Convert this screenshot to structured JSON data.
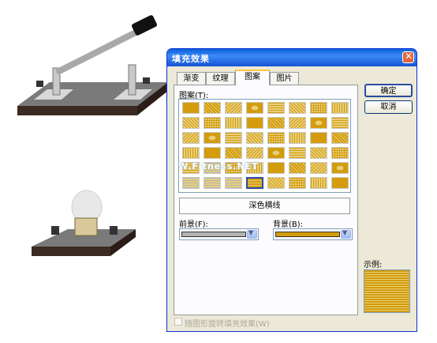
{
  "dialog": {
    "title": "填充效果",
    "close_symbol": "✕",
    "tabs": [
      {
        "label": "渐变",
        "active": false
      },
      {
        "label": "纹理",
        "active": false
      },
      {
        "label": "图案",
        "active": true
      },
      {
        "label": "图片",
        "active": false
      }
    ],
    "pattern_label": "图案(T):",
    "selected_pattern_name": "深色横线",
    "foreground_label": "前景(F):",
    "background_label": "背景(B):",
    "foreground_color": "#b4b4b4",
    "background_color": "#d49c0c",
    "ok_button": "确定",
    "cancel_button": "取消",
    "preview_label": "示例:",
    "rotate_checkbox_label": "随图形旋转填充效果(W)",
    "rotate_checkbox_checked": false,
    "watermark": "W.Fitness.NET"
  },
  "colors": {
    "accent": "#0a5fd8",
    "pattern_fill": "#d49c0c",
    "pattern_light": "#e7cf7a"
  }
}
